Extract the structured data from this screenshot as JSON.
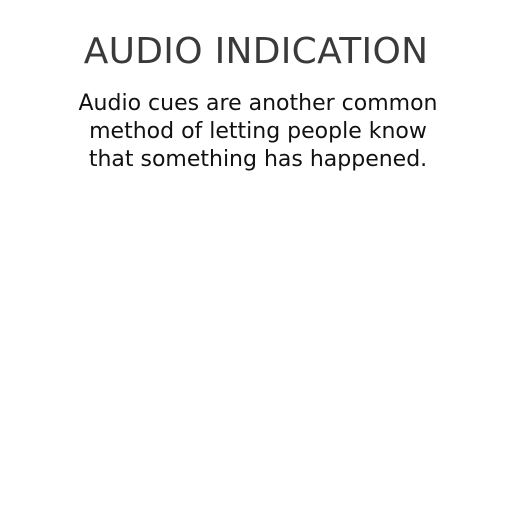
{
  "slide": {
    "title": "AUDIO INDICATION",
    "body": "Audio cues are another common method of letting people know that something has happened."
  }
}
